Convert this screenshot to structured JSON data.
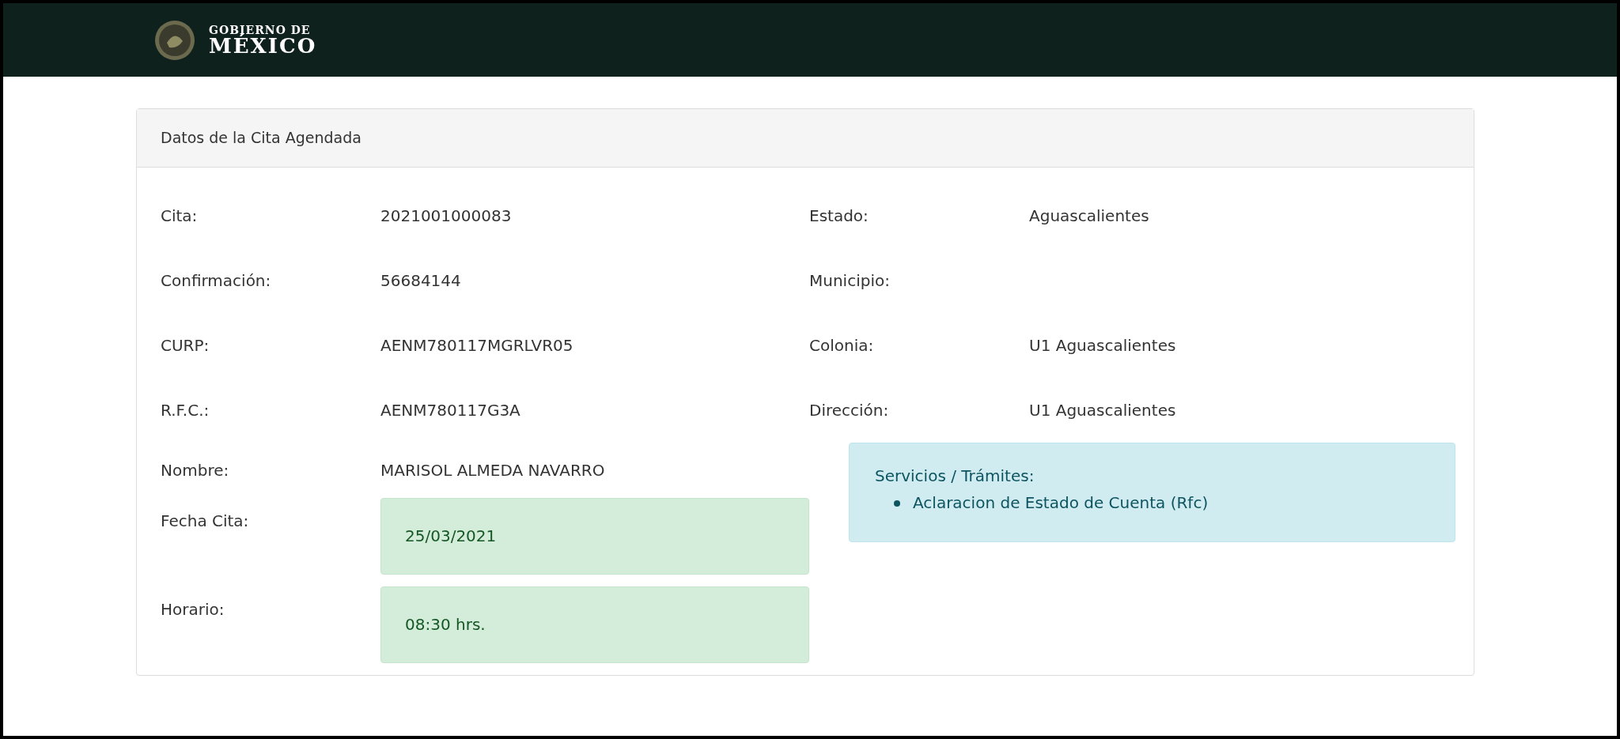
{
  "header": {
    "logo_line_1": "GOBIERNO DE",
    "logo_line_2": "MÉXICO"
  },
  "card": {
    "title": "Datos de la Cita Agendada",
    "left_fields": [
      {
        "label": "Cita:",
        "value": "2021001000083"
      },
      {
        "label": "Confirmación:",
        "value": "56684144"
      },
      {
        "label": "CURP:",
        "value": "AENM780117MGRLVR05"
      },
      {
        "label": "R.F.C.:",
        "value": "AENM780117G3A"
      },
      {
        "label": "Nombre:",
        "value": "MARISOL ALMEDA NAVARRO"
      }
    ],
    "right_fields": [
      {
        "label": "Estado:",
        "value": "Aguascalientes"
      },
      {
        "label": "Municipio:"
      },
      {
        "label": "Colonia:",
        "value": "U1 Aguascalientes"
      },
      {
        "label": "Dirección:",
        "value": "U1 Aguascalientes"
      }
    ],
    "highlight_fields": [
      {
        "label": "Fecha Cita:",
        "value": "25/03/2021"
      },
      {
        "label": "Horario:",
        "value": "08:30 hrs."
      }
    ],
    "services": {
      "title": "Servicios / Trámites:",
      "items": [
        "Aclaracion de Estado de Cuenta (Rfc)"
      ]
    }
  }
}
